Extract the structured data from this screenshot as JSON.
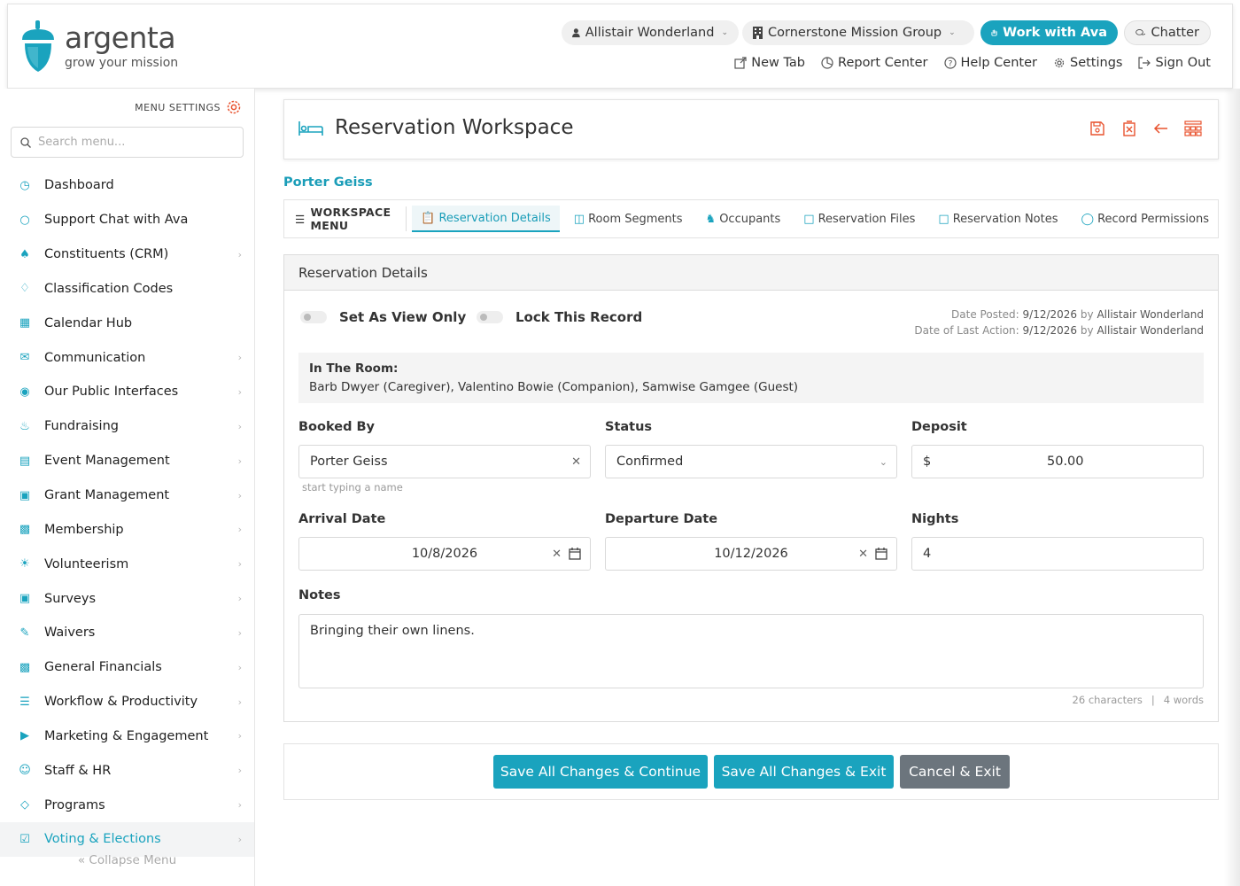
{
  "brand": {
    "name": "argenta",
    "tagline": "grow your mission"
  },
  "header": {
    "user": "Allistair Wonderland",
    "org": "Cornerstone Mission Group",
    "ava_button": "Work with Ava",
    "chatter": "Chatter",
    "links": [
      "New Tab",
      "Report Center",
      "Help Center",
      "Settings",
      "Sign Out"
    ]
  },
  "sidebar": {
    "menu_settings": "MENU SETTINGS",
    "search_placeholder": "Search menu...",
    "items": [
      {
        "label": "Dashboard",
        "icon": "dashboard-icon",
        "chevron": false
      },
      {
        "label": "Support Chat with Ava",
        "icon": "chat-icon",
        "chevron": false
      },
      {
        "label": "Constituents (CRM)",
        "icon": "people-icon",
        "chevron": true
      },
      {
        "label": "Classification Codes",
        "icon": "tag-icon",
        "chevron": false
      },
      {
        "label": "Calendar Hub",
        "icon": "calendar-icon",
        "chevron": false
      },
      {
        "label": "Communication",
        "icon": "envelope-icon",
        "chevron": true
      },
      {
        "label": "Our Public Interfaces",
        "icon": "globe-icon",
        "chevron": true
      },
      {
        "label": "Fundraising",
        "icon": "hand-coin-icon",
        "chevron": true
      },
      {
        "label": "Event Management",
        "icon": "event-icon",
        "chevron": true
      },
      {
        "label": "Grant Management",
        "icon": "grant-icon",
        "chevron": true
      },
      {
        "label": "Membership",
        "icon": "id-card-icon",
        "chevron": true
      },
      {
        "label": "Volunteerism",
        "icon": "volunteer-icon",
        "chevron": true
      },
      {
        "label": "Surveys",
        "icon": "chart-icon",
        "chevron": true
      },
      {
        "label": "Waivers",
        "icon": "sign-icon",
        "chevron": true
      },
      {
        "label": "General Financials",
        "icon": "money-icon",
        "chevron": true
      },
      {
        "label": "Workflow & Productivity",
        "icon": "list-check-icon",
        "chevron": true
      },
      {
        "label": "Marketing & Engagement",
        "icon": "megaphone-icon",
        "chevron": true
      },
      {
        "label": "Staff & HR",
        "icon": "user-icon",
        "chevron": true
      },
      {
        "label": "Programs",
        "icon": "programs-icon",
        "chevron": true
      },
      {
        "label": "Voting & Elections",
        "icon": "ballot-icon",
        "chevron": true
      }
    ],
    "collapse": "Collapse Menu"
  },
  "workspace": {
    "title": "Reservation Workspace",
    "record_name": "Porter Geiss",
    "menu_label": "WORKSPACE MENU",
    "tabs": [
      "Reservation Details",
      "Room Segments",
      "Occupants",
      "Reservation Files",
      "Reservation Notes",
      "Record Permissions"
    ]
  },
  "details": {
    "heading": "Reservation Details",
    "toggle_view_only": "Set As View Only",
    "toggle_lock": "Lock This Record",
    "date_posted_label": "Date Posted:",
    "date_posted": "9/12/2026",
    "date_posted_by": "Allistair Wonderland",
    "last_action_label": "Date of Last Action:",
    "last_action": "9/12/2026",
    "last_action_by": "Allistair Wonderland",
    "by_word": "by",
    "in_room_label": "In The Room:",
    "in_room": "Barb Dwyer (Caregiver), Valentino Bowie (Companion), Samwise Gamgee (Guest)",
    "booked_by_label": "Booked By",
    "booked_by": "Porter Geiss",
    "booked_by_hint": "start typing a name",
    "status_label": "Status",
    "status": "Confirmed",
    "deposit_label": "Deposit",
    "deposit_currency": "$",
    "deposit": "50.00",
    "arrival_label": "Arrival Date",
    "arrival": "10/8/2026",
    "departure_label": "Departure Date",
    "departure": "10/12/2026",
    "nights_label": "Nights",
    "nights": "4",
    "notes_label": "Notes",
    "notes": "Bringing their own linens.",
    "char_count": "26 characters",
    "word_count": "4 words"
  },
  "buttons": {
    "save_continue": "Save All Changes & Continue",
    "save_exit": "Save All Changes & Exit",
    "cancel_exit": "Cancel & Exit"
  },
  "colors": {
    "accent": "#1aa3be",
    "action_red": "#e8532f",
    "cancel_grey": "#6c757d"
  }
}
